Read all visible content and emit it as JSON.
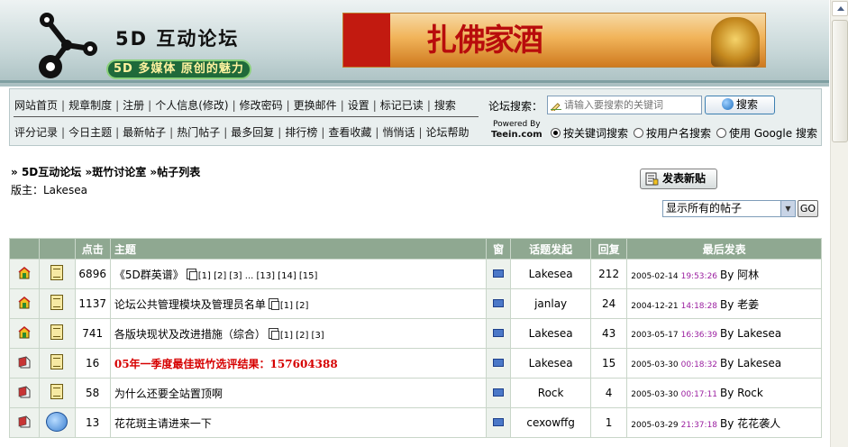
{
  "header": {
    "site_title": "5D 互动论坛",
    "slogan": "5D 多媒体 原创的魅力",
    "banner_text": "扎佛家酒"
  },
  "nav": {
    "row1": [
      "网站首页",
      "规章制度",
      "注册",
      "个人信息(修改)",
      "修改密码",
      "更换邮件",
      "设置",
      "标记已读",
      "搜索"
    ],
    "row2": [
      "评分记录",
      "今日主题",
      "最新帖子",
      "热门帖子",
      "最多回复",
      "排行榜",
      "查看收藏",
      "悄悄话",
      "论坛帮助"
    ]
  },
  "search": {
    "label": "论坛搜索：",
    "placeholder": "请输入要搜索的关键词",
    "button_label": "搜索",
    "powered_by": "Powered By",
    "powered_brand": "Teein.com",
    "options": [
      "按关键词搜索",
      "按用户名搜索",
      "使用 Google 搜索"
    ],
    "selected_option": "按关键词搜索"
  },
  "breadcrumb": {
    "items": [
      "5D互动论坛",
      "斑竹讨论室",
      "帖子列表"
    ],
    "separator": "»"
  },
  "moderator": "版主：Lakesea",
  "toolbar": {
    "new_post_label": "发表新贴",
    "filter_selected": "显示所有的帖子",
    "go_label": "GO"
  },
  "table": {
    "headers": {
      "status": "",
      "mood": "",
      "views": "点击",
      "title": "主题",
      "window": "窗",
      "author": "话题发起",
      "replies": "回复",
      "last": "最后发表"
    },
    "rows": [
      {
        "status": "hot-topic",
        "mood": "note",
        "views": "6896",
        "title": "《5D群英谱》",
        "multi_page": true,
        "pages": "[1] [2] [3] ... [13] [14] [15]",
        "highlight": false,
        "author": "Lakesea",
        "replies": "212",
        "last_date": "2005-02-14",
        "last_time": "19:53:26",
        "last_by": "By 阿林"
      },
      {
        "status": "hot-topic",
        "mood": "note",
        "views": "1137",
        "title": "论坛公共管理模块及管理员名单",
        "multi_page": true,
        "pages": "[1] [2]",
        "highlight": false,
        "author": "janlay",
        "replies": "24",
        "last_date": "2004-12-21",
        "last_time": "14:18:28",
        "last_by": "By 老姜"
      },
      {
        "status": "hot-topic",
        "mood": "note",
        "views": "741",
        "title": "各版块现状及改进措施（综合）",
        "multi_page": true,
        "pages": "[1] [2] [3]",
        "highlight": false,
        "author": "Lakesea",
        "replies": "43",
        "last_date": "2003-05-17",
        "last_time": "16:36:39",
        "last_by": "By Lakesea"
      },
      {
        "status": "normal-topic",
        "mood": "note",
        "views": "16",
        "title": "05年一季度最佳斑竹选评结果：157604388",
        "multi_page": false,
        "pages": "",
        "highlight": true,
        "author": "Lakesea",
        "replies": "15",
        "last_date": "2005-03-30",
        "last_time": "00:18:32",
        "last_by": "By Lakesea"
      },
      {
        "status": "normal-topic",
        "mood": "note",
        "views": "58",
        "title": "为什么还要全站置顶啊",
        "multi_page": false,
        "pages": "",
        "highlight": false,
        "author": "Rock",
        "replies": "4",
        "last_date": "2005-03-30",
        "last_time": "00:17:11",
        "last_by": "By Rock"
      },
      {
        "status": "normal-topic",
        "mood": "smile",
        "views": "13",
        "title": "花花斑主请进来一下",
        "multi_page": false,
        "pages": "",
        "highlight": false,
        "author": "cexowffg",
        "replies": "1",
        "last_date": "2005-03-29",
        "last_time": "21:37:18",
        "last_by": "By 花花袭人"
      }
    ]
  },
  "colors": {
    "table_header": "#8fa891",
    "highlight_title": "#d60000",
    "last_time": "#9b1fa0"
  }
}
